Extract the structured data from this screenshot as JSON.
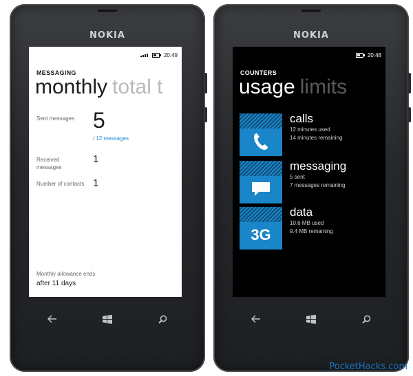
{
  "phones": {
    "left": {
      "brand": "NOKIA",
      "time": "20:49",
      "app_title": "MESSAGING",
      "pivot_active": "monthly",
      "pivot_inactive": "total t",
      "rows": [
        {
          "label": "Sent messages",
          "value": "5",
          "sub": "/ 12 messages"
        },
        {
          "label": "Received messages",
          "value": "1"
        },
        {
          "label": "Number of contacts",
          "value": "1"
        }
      ],
      "allowance_label": "Monthly allowance ends",
      "allowance_value": "after 11 days"
    },
    "right": {
      "brand": "NOKIA",
      "time": "20:48",
      "app_title": "COUNTERS",
      "pivot_active": "usage",
      "pivot_inactive": "limits",
      "tiles": [
        {
          "icon": "phone-icon",
          "name": "calls",
          "line1": "12 minutes used",
          "line2": "14 minutes remaining"
        },
        {
          "icon": "message-icon",
          "name": "messaging",
          "line1": "5 sent",
          "line2": "7 messages remaining"
        },
        {
          "icon": "3g-icon",
          "label": "3G",
          "name": "data",
          "line1": "10.6 MB used",
          "line2": "9.4 MB remaining"
        }
      ]
    }
  },
  "nav_icons": [
    "back-arrow-icon",
    "windows-logo-icon",
    "search-icon"
  ],
  "colors": {
    "accent": "#1a86c9",
    "link": "#1b8fd6",
    "watermark": "#1b74c5"
  },
  "watermark": "PocketHacks.com"
}
